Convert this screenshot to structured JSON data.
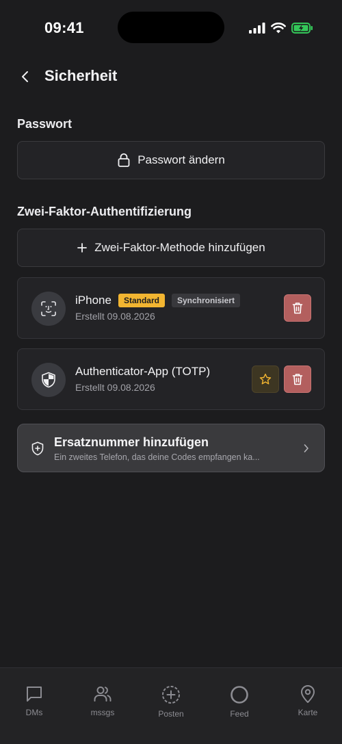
{
  "status_bar": {
    "time": "09:41"
  },
  "header": {
    "title": "Sicherheit"
  },
  "password_section": {
    "label": "Passwort",
    "change_button": "Passwort ändern"
  },
  "twofa_section": {
    "label": "Zwei-Faktor-Authentifizierung",
    "add_button": "Zwei-Faktor-Methode hinzufügen",
    "methods": [
      {
        "name": "iPhone",
        "badge_default": "Standard",
        "badge_sync": "Synchronisiert",
        "subtitle": "Erstellt 09.08.2026",
        "icon": "face-id-icon"
      },
      {
        "name": "Authenticator-App (TOTP)",
        "subtitle": "Erstellt 09.08.2026",
        "icon": "shield-icon"
      }
    ]
  },
  "backup": {
    "title": "Ersatznummer hinzufügen",
    "subtitle": "Ein zweites Telefon, das deine Codes empfangen ka..."
  },
  "tab_bar": {
    "items": [
      {
        "label": "DMs",
        "icon": "chat-bubble-icon"
      },
      {
        "label": "mssgs",
        "icon": "users-icon"
      },
      {
        "label": "Posten",
        "icon": "plus-circle-icon"
      },
      {
        "label": "Feed",
        "icon": "circle-icon"
      },
      {
        "label": "Karte",
        "icon": "map-pin-icon"
      }
    ]
  },
  "colors": {
    "background": "#1c1c1e",
    "card": "#232326",
    "badge_default": "#f2b531",
    "delete": "#b35f5e",
    "battery": "#34c759"
  }
}
